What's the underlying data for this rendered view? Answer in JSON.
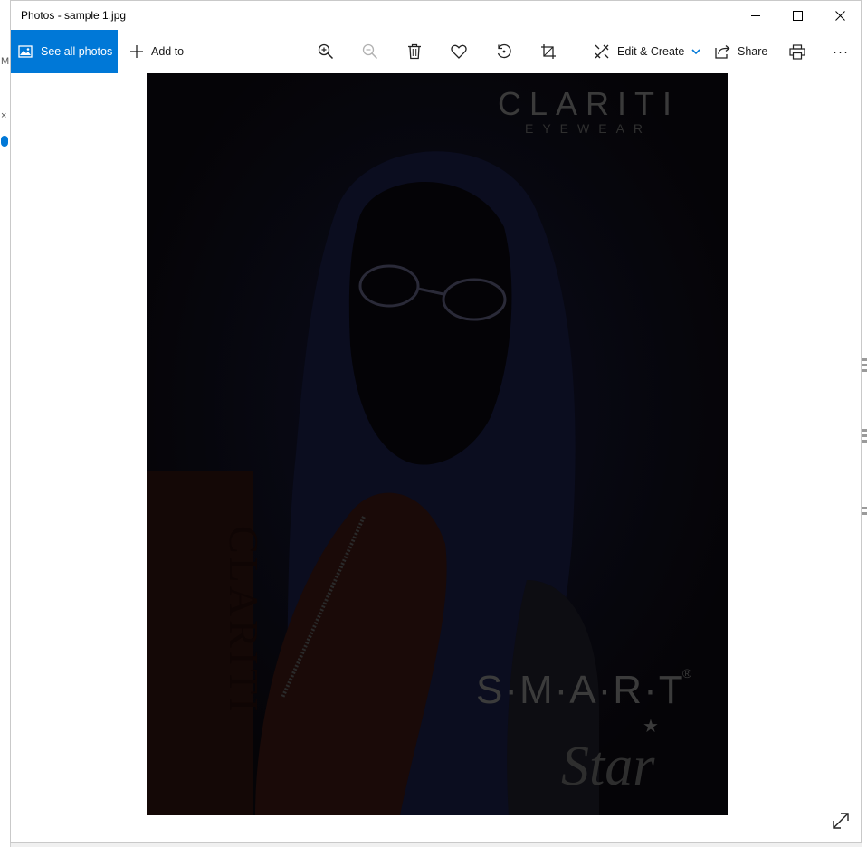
{
  "window": {
    "title": "Photos - sample 1.jpg"
  },
  "toolbar": {
    "see_all_label": "See all photos",
    "add_to_label": "Add to",
    "edit_create_label": "Edit & Create",
    "share_label": "Share",
    "more_label": "···"
  },
  "photo": {
    "brand_top": "CLARITI",
    "brand_top_sub": "EYEWEAR",
    "brand_side": "CLARITI",
    "brand_bottom": "S·M·A·R·T",
    "brand_registered": "®",
    "brand_script": "Star"
  },
  "colors": {
    "accent": "#0078d7",
    "photo_bg": "#050407"
  },
  "icons": [
    "image-icon",
    "plus-icon",
    "zoom-in-icon",
    "zoom-out-icon",
    "delete-icon",
    "heart-icon",
    "rotate-icon",
    "crop-icon",
    "edit-icon",
    "chevron-down-icon",
    "share-icon",
    "print-icon",
    "more-icon",
    "minimize-icon",
    "maximize-icon",
    "close-icon",
    "expand-icon"
  ]
}
